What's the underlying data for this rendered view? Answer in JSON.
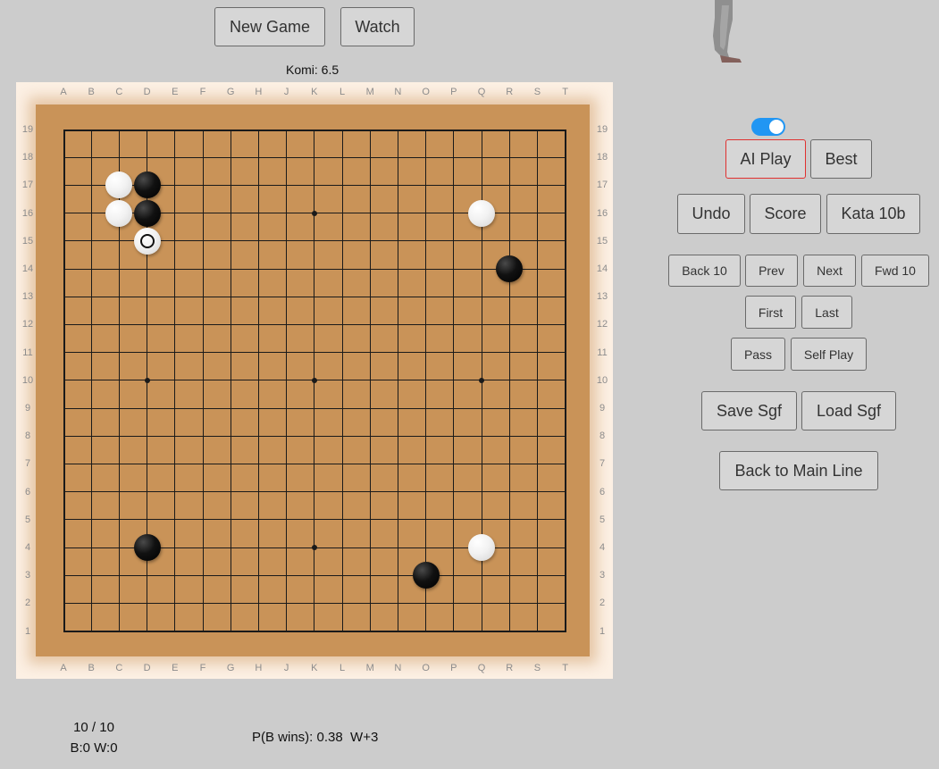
{
  "header": {
    "new_game": "New Game",
    "watch": "Watch",
    "komi": "Komi: 6.5"
  },
  "board": {
    "size": 19,
    "columns": [
      "A",
      "B",
      "C",
      "D",
      "E",
      "F",
      "G",
      "H",
      "J",
      "K",
      "L",
      "M",
      "N",
      "O",
      "P",
      "Q",
      "R",
      "S",
      "T"
    ],
    "rows": [
      "19",
      "18",
      "17",
      "16",
      "15",
      "14",
      "13",
      "12",
      "11",
      "10",
      "9",
      "8",
      "7",
      "6",
      "5",
      "4",
      "3",
      "2",
      "1"
    ],
    "hoshi": [
      "D16",
      "K16",
      "Q16",
      "D10",
      "K10",
      "Q10",
      "D4",
      "K4",
      "Q4"
    ],
    "stones": [
      {
        "point": "C17",
        "color": "white"
      },
      {
        "point": "D17",
        "color": "black"
      },
      {
        "point": "C16",
        "color": "white"
      },
      {
        "point": "D16",
        "color": "black"
      },
      {
        "point": "D15",
        "color": "white",
        "last_move": true
      },
      {
        "point": "Q16",
        "color": "white"
      },
      {
        "point": "R14",
        "color": "black"
      },
      {
        "point": "D4",
        "color": "black"
      },
      {
        "point": "Q4",
        "color": "white"
      },
      {
        "point": "O3",
        "color": "black"
      }
    ],
    "colors": {
      "wood": "#c99358",
      "line": "#1a1a1a"
    }
  },
  "controls": {
    "ai_toggle_on": true,
    "ai_play": "AI Play",
    "best": "Best",
    "undo": "Undo",
    "score": "Score",
    "kata": "Kata 10b",
    "back10": "Back 10",
    "prev": "Prev",
    "next": "Next",
    "fwd10": "Fwd 10",
    "first": "First",
    "last": "Last",
    "pass": "Pass",
    "self_play": "Self Play",
    "save_sgf": "Save Sgf",
    "load_sgf": "Load Sgf",
    "back_main": "Back to Main Line",
    "accent": "#2196f3",
    "active_border": "#e0302f"
  },
  "status": {
    "move_count": "10 / 10",
    "captures": "B:0 W:0",
    "win_prob": "P(B wins): 0.38  W+3"
  }
}
